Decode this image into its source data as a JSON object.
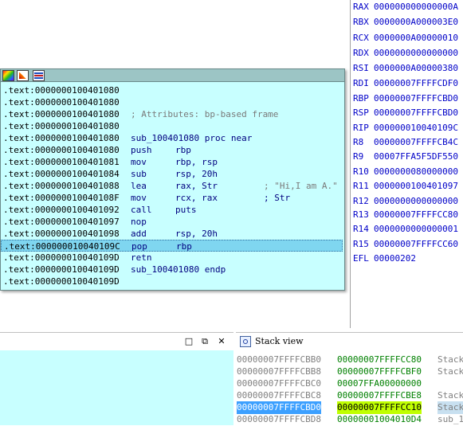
{
  "registers": [
    {
      "name": "RAX",
      "value": "000000000000000A"
    },
    {
      "name": "RBX",
      "value": "0000000A000003E0"
    },
    {
      "name": "RCX",
      "value": "0000000A00000010"
    },
    {
      "name": "RDX",
      "value": "0000000000000000"
    },
    {
      "name": "RSI",
      "value": "0000000A00000380"
    },
    {
      "name": "RDI",
      "value": "00000007FFFFCDF0"
    },
    {
      "name": "RBP",
      "value": "00000007FFFFCBD0"
    },
    {
      "name": "RSP",
      "value": "00000007FFFFCBD0"
    },
    {
      "name": "RIP",
      "value": "000000010040109C"
    },
    {
      "name": "R8",
      "value": "00000007FFFFCB4C"
    },
    {
      "name": "R9",
      "value": "00007FFA5F5DF550"
    },
    {
      "name": "R10",
      "value": "0000000080000000"
    },
    {
      "name": "R11",
      "value": "0000000100401097"
    },
    {
      "name": "R12",
      "value": "0000000000000000"
    },
    {
      "name": "R13",
      "value": "00000007FFFFCC80"
    },
    {
      "name": "R14",
      "value": "0000000000000001"
    },
    {
      "name": "R15",
      "value": "00000007FFFFCC60"
    },
    {
      "name": "EFL",
      "value": "00000202"
    }
  ],
  "listing": [
    {
      "addr": ".text:0000000100401080",
      "mn": "",
      "op": "",
      "cm": ""
    },
    {
      "addr": ".text:0000000100401080",
      "mn": "",
      "op": "",
      "cm": ""
    },
    {
      "addr": ".text:0000000100401080",
      "mn": "",
      "op": "",
      "cm": "; Attributes: bp-based frame"
    },
    {
      "addr": ".text:0000000100401080",
      "mn": "",
      "op": "",
      "cm": ""
    },
    {
      "addr": ".text:0000000100401080",
      "mn": "sub_100401080 proc near",
      "op": "",
      "cm": ""
    },
    {
      "addr": ".text:0000000100401080",
      "mn": "push",
      "op": "rbp",
      "cm": ""
    },
    {
      "addr": ".text:0000000100401081",
      "mn": "mov",
      "op": "rbp, rsp",
      "cm": ""
    },
    {
      "addr": ".text:0000000100401084",
      "mn": "sub",
      "op": "rsp, 20h",
      "cm": ""
    },
    {
      "addr": ".text:0000000100401088",
      "mn": "lea",
      "op": "rax, Str",
      "cm": "; \"Hi,I am A.\""
    },
    {
      "addr": ".text:000000010040108F",
      "mn": "mov",
      "op": "rcx, rax",
      "cm": "; Str"
    },
    {
      "addr": ".text:0000000100401092",
      "mn": "call",
      "op": "puts",
      "cm": ""
    },
    {
      "addr": ".text:0000000100401097",
      "mn": "nop",
      "op": "",
      "cm": ""
    },
    {
      "addr": ".text:0000000100401098",
      "mn": "add",
      "op": "rsp, 20h",
      "cm": ""
    },
    {
      "addr": ".text:000000010040109C",
      "mn": "pop",
      "op": "rbp",
      "cm": ""
    },
    {
      "addr": ".text:000000010040109D",
      "mn": "retn",
      "op": "",
      "cm": ""
    },
    {
      "addr": ".text:000000010040109D",
      "mn": "sub_100401080 endp",
      "op": "",
      "cm": ""
    },
    {
      "addr": ".text:000000010040109D",
      "mn": "",
      "op": "",
      "cm": ""
    }
  ],
  "selected_line": 13,
  "stack_view": {
    "title": "Stack view",
    "rows": [
      {
        "addr": "00000007FFFFCBB0",
        "val": "00000007FFFFCC80",
        "cm": "Stack"
      },
      {
        "addr": "00000007FFFFCBB8",
        "val": "00000007FFFFCBF0",
        "cm": "Stack"
      },
      {
        "addr": "00000007FFFFCBC0",
        "val": "00007FFA00000000",
        "cm": ""
      },
      {
        "addr": "00000007FFFFCBC8",
        "val": "00000007FFFFCBE8",
        "cm": "Stack"
      },
      {
        "addr": "00000007FFFFCBD0",
        "val": "00000007FFFFCC10",
        "cm": "Stack"
      },
      {
        "addr": "00000007FFFFCBD8",
        "val": "00000001004010D4",
        "cm": "sub_1"
      }
    ]
  },
  "panel_buttons": {
    "restore": "□",
    "float": "⧉",
    "close": "✕"
  },
  "colors": {
    "popup_bg": "#c8ffff",
    "selection": "#7fd6f0",
    "register_text": "#0000c8",
    "stack_value": "#008000"
  }
}
